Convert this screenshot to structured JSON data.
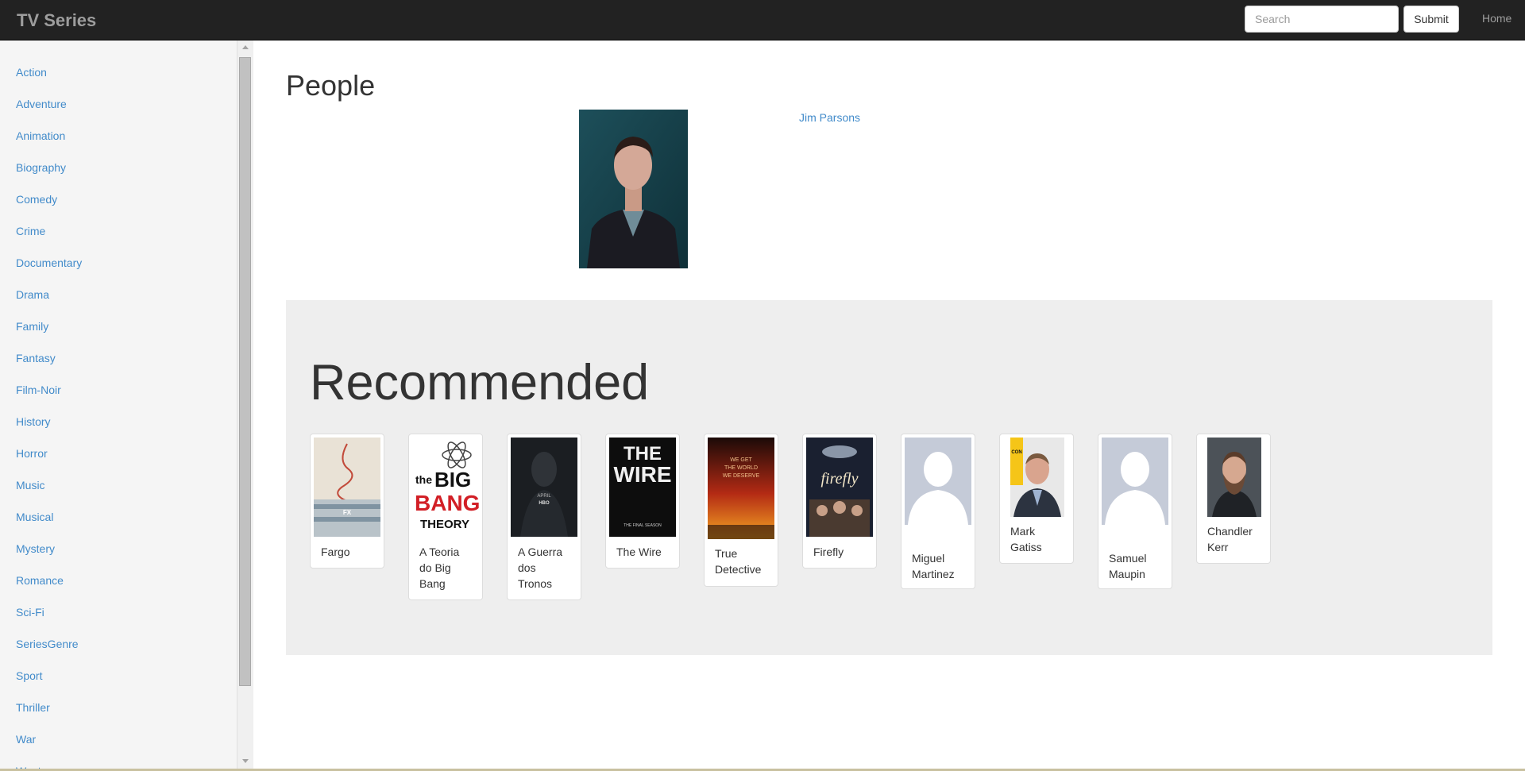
{
  "navbar": {
    "brand": "TV Series",
    "search_placeholder": "Search",
    "submit_label": "Submit",
    "home_label": "Home"
  },
  "sidebar": {
    "items": [
      {
        "label": "Action"
      },
      {
        "label": "Adventure"
      },
      {
        "label": "Animation"
      },
      {
        "label": "Biography"
      },
      {
        "label": "Comedy"
      },
      {
        "label": "Crime"
      },
      {
        "label": "Documentary"
      },
      {
        "label": "Drama"
      },
      {
        "label": "Family"
      },
      {
        "label": "Fantasy"
      },
      {
        "label": "Film-Noir"
      },
      {
        "label": "History"
      },
      {
        "label": "Horror"
      },
      {
        "label": "Music"
      },
      {
        "label": "Musical"
      },
      {
        "label": "Mystery"
      },
      {
        "label": "Romance"
      },
      {
        "label": "Sci-Fi"
      },
      {
        "label": "SeriesGenre"
      },
      {
        "label": "Sport"
      },
      {
        "label": "Thriller"
      },
      {
        "label": "War"
      },
      {
        "label": "Western"
      }
    ]
  },
  "main": {
    "heading": "People",
    "person": {
      "name": "Jim Parsons"
    }
  },
  "recommended": {
    "heading": "Recommended",
    "items": [
      {
        "caption": "Fargo"
      },
      {
        "caption": "A Teoria do Big Bang"
      },
      {
        "caption": "A Guerra dos Tronos"
      },
      {
        "caption": "The Wire"
      },
      {
        "caption": "True Detective"
      },
      {
        "caption": "Firefly"
      },
      {
        "caption": "Miguel Martinez"
      },
      {
        "caption": "Mark Gatiss"
      },
      {
        "caption": "Samuel Maupin"
      },
      {
        "caption": "Chandler Kerr"
      }
    ]
  },
  "poster_text": {
    "fargo_fx": "FX",
    "bigbang_the": "the",
    "bigbang_big": "BIG",
    "bigbang_bang": "BANG",
    "bigbang_theory": "THEORY",
    "got_april": "APRIL",
    "got_hbo": "HBO",
    "wire_the": "THE",
    "wire_wire": "WIRE",
    "wire_sub": "THE FINAL SEASON",
    "td_line1": "WE GET",
    "td_line2": "THE WORLD",
    "td_line3": "WE DESERVE",
    "firefly_title": "firefly",
    "gatiss_badge": "CON"
  }
}
